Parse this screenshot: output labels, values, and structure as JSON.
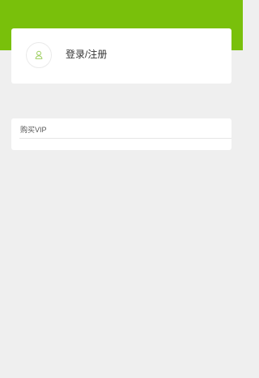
{
  "header": {
    "background_color": "#79c00b"
  },
  "user": {
    "avatar_icon": "user-icon",
    "login_label": "登录/注册"
  },
  "menu": {
    "items": [
      {
        "label": "购买VIP"
      }
    ]
  },
  "colors": {
    "page_background": "#efefef",
    "card_background": "#ffffff",
    "avatar_icon_color": "#9acd5a"
  }
}
